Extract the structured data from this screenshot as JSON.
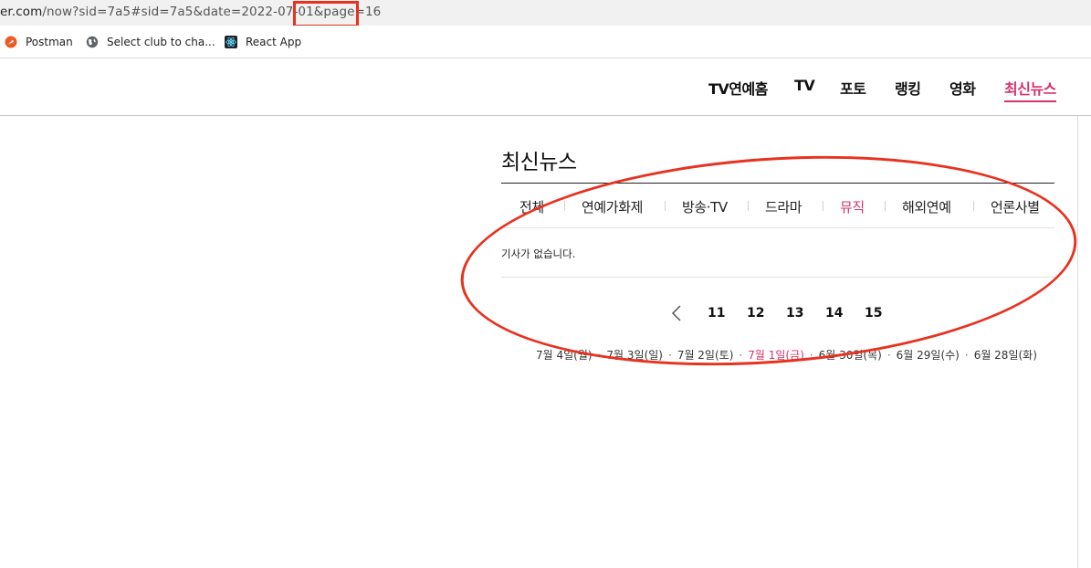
{
  "browser": {
    "url_host_fragment": "er.com",
    "url_path": "/now?sid=7a5#sid=7a5&date=2022-07-01&page=16",
    "bookmarks": [
      {
        "label": "Postman",
        "icon": "postman-icon"
      },
      {
        "label": "Select club to cha...",
        "icon": "globe-icon"
      },
      {
        "label": "React App",
        "icon": "react-icon"
      }
    ]
  },
  "site_nav": {
    "items": [
      {
        "label": "TV연예홈",
        "active": false
      },
      {
        "label": "TV",
        "active": false
      },
      {
        "label": "포토",
        "active": false
      },
      {
        "label": "랭킹",
        "active": false
      },
      {
        "label": "영화",
        "active": false
      },
      {
        "label": "최신뉴스",
        "active": true
      }
    ]
  },
  "page": {
    "title": "최신뉴스",
    "categories": [
      {
        "label": "전체",
        "active": false
      },
      {
        "label": "연예가화제",
        "active": false
      },
      {
        "label": "방송·TV",
        "active": false
      },
      {
        "label": "드라마",
        "active": false
      },
      {
        "label": "뮤직",
        "active": true
      },
      {
        "label": "해외연예",
        "active": false
      },
      {
        "label": "언론사별",
        "active": false
      }
    ],
    "empty_message": "기사가 없습니다.",
    "pagination": {
      "prev_icon": "chevron-left-icon",
      "pages": [
        "11",
        "12",
        "13",
        "14",
        "15"
      ]
    },
    "dates": [
      {
        "label": "7월 4일(월)",
        "active": false
      },
      {
        "label": "7월 3일(일)",
        "active": false
      },
      {
        "label": "7월 2일(토)",
        "active": false
      },
      {
        "label": "7월 1일(금)",
        "active": true
      },
      {
        "label": "6월 30일(목)",
        "active": false
      },
      {
        "label": "6월 29일(수)",
        "active": false
      },
      {
        "label": "6월 28일(화)",
        "active": false
      }
    ],
    "date_separator": "·"
  },
  "colors": {
    "accent": "#d6336c",
    "annotation": "#e8321f"
  }
}
